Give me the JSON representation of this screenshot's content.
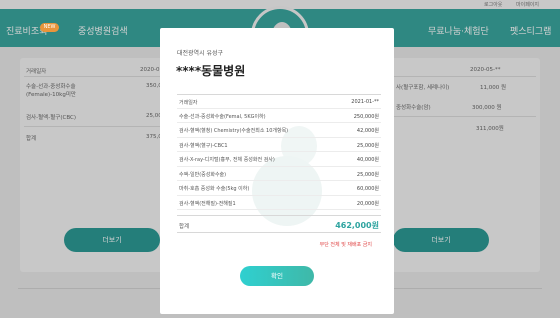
{
  "top_links": [
    "로그아웃",
    "마이페이지"
  ],
  "nav": {
    "badge": "NEW",
    "items": [
      "진료비조회",
      "중성병원검색",
      "무료나눔·체험단",
      "펫스티그램"
    ]
  },
  "background": {
    "left_card": {
      "rows": [
        {
          "label": "거래일자",
          "value": "2020-01-**"
        },
        {
          "label": "수술-선과-중성화수술 (Female)-10kg미만",
          "value": "350,0"
        },
        {
          "label": "검사-혈액-혈구(CBC)",
          "value": "25,00"
        },
        {
          "label": "합계",
          "value": "375,0"
        }
      ],
      "button": "더보기"
    },
    "right_card": {
      "rows": [
        {
          "label": "거래일자",
          "value": "2020-05-**"
        },
        {
          "label": "사(혈구포함, 세례나이)",
          "value": "11,000 원"
        },
        {
          "label": "중성화수술(암)",
          "value": "300,000 원"
        },
        {
          "label": "",
          "value": "311,000원"
        }
      ],
      "button": "더보기"
    }
  },
  "modal": {
    "region": "대전광역시 유성구",
    "hospital_name": "****동물병원",
    "header": {
      "label": "거래일자",
      "value": "2021-01-**"
    },
    "items": [
      {
        "label": "수술-선과-중성화수술(Femal, 5KG이하)",
        "value": "250,000원"
      },
      {
        "label": "검사-혈액(혈청) Chemistry(수술전최소 10개항목)",
        "value": "42,000원"
      },
      {
        "label": "검사-혈액(혈구)-CBC1",
        "value": "25,000원"
      },
      {
        "label": "검사-X-ray-디지털(흉부, 전체 중성화전 검사)",
        "value": "40,000원"
      },
      {
        "label": "수액-일반(중성화수술)",
        "value": "25,000원"
      },
      {
        "label": "마취-호흡 중성화 수술(5kg 이하)",
        "value": "60,000원"
      },
      {
        "label": "검사-혈액(전해질)-전해질1",
        "value": "20,000원"
      }
    ],
    "total": {
      "label": "합계",
      "value": "462,000원"
    },
    "note": "부단 전체 및 재배포 금지",
    "confirm": "확인"
  }
}
